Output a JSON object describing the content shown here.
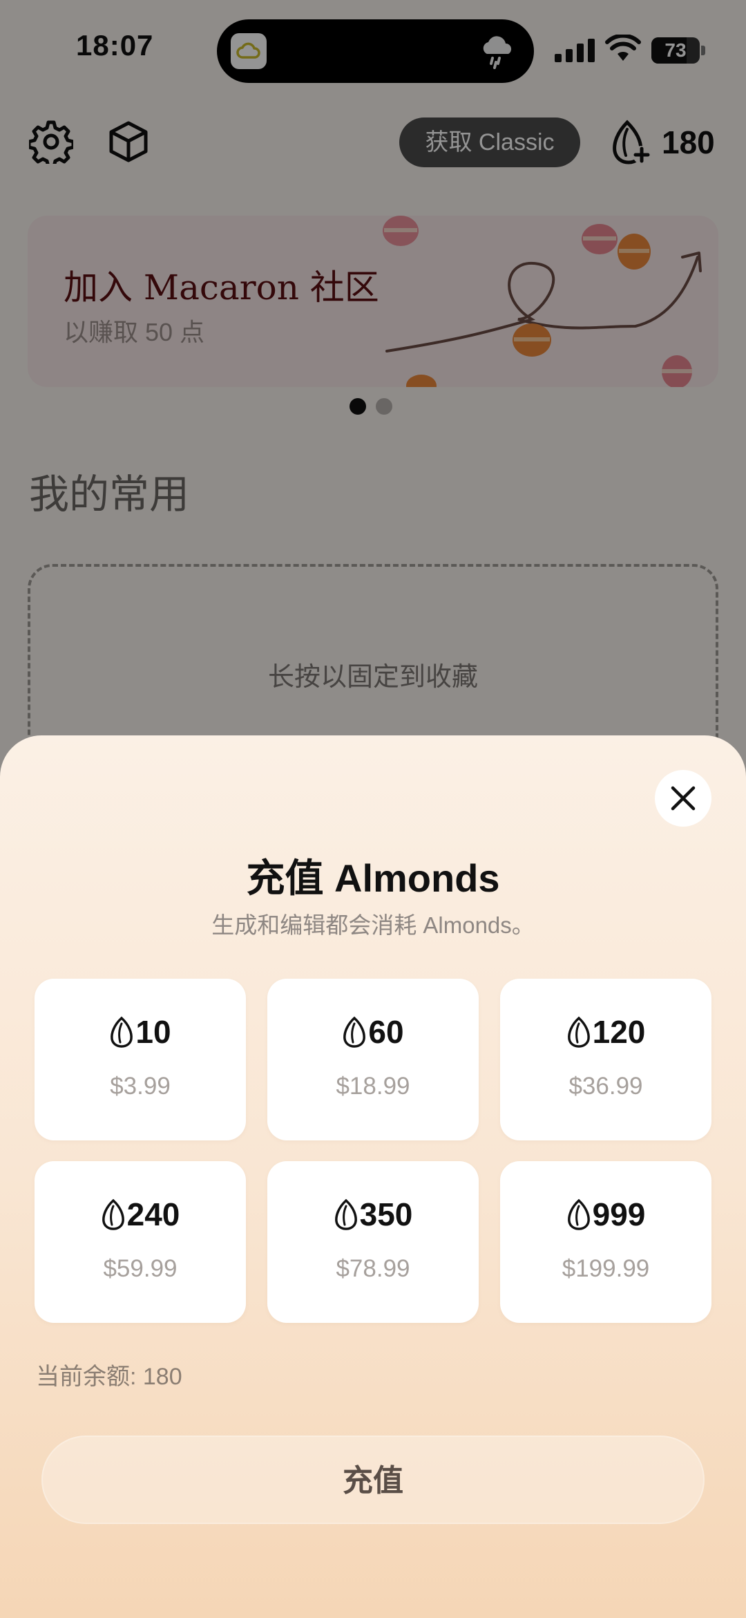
{
  "status_bar": {
    "time": "18:07",
    "battery": "73",
    "battery_level": 0.73,
    "island_left_icon": "cloud-app-icon",
    "island_right_icon": "rain-cloud-icon"
  },
  "toolbar": {
    "settings_icon": "gear-icon",
    "box_icon": "cube-icon",
    "classic_button": "获取 Classic",
    "credits_value": "180",
    "credits_icon": "almond-plus-icon"
  },
  "banner": {
    "title": "加入 Macaron 社区",
    "subtitle": "以赚取 50 点",
    "active_page": 1,
    "page_count": 2
  },
  "favorites": {
    "title": "我的常用",
    "empty_hint": "长按以固定到收藏"
  },
  "sheet": {
    "title": "充值 Almonds",
    "subtitle": "生成和编辑都会消耗 Almonds。",
    "packages": [
      {
        "amount": "10",
        "price": "$3.99"
      },
      {
        "amount": "60",
        "price": "$18.99"
      },
      {
        "amount": "120",
        "price": "$36.99"
      },
      {
        "amount": "240",
        "price": "$59.99"
      },
      {
        "amount": "350",
        "price": "$78.99"
      },
      {
        "amount": "999",
        "price": "$199.99"
      }
    ],
    "balance": "当前余额: 180",
    "recharge_button": "充值",
    "close_icon": "close-icon"
  },
  "colors": {
    "banner_title": "#5a0e12",
    "sheet_top": "#fbf0e5",
    "sheet_bottom": "#f5d6b6",
    "accent_dark": "#111111"
  }
}
